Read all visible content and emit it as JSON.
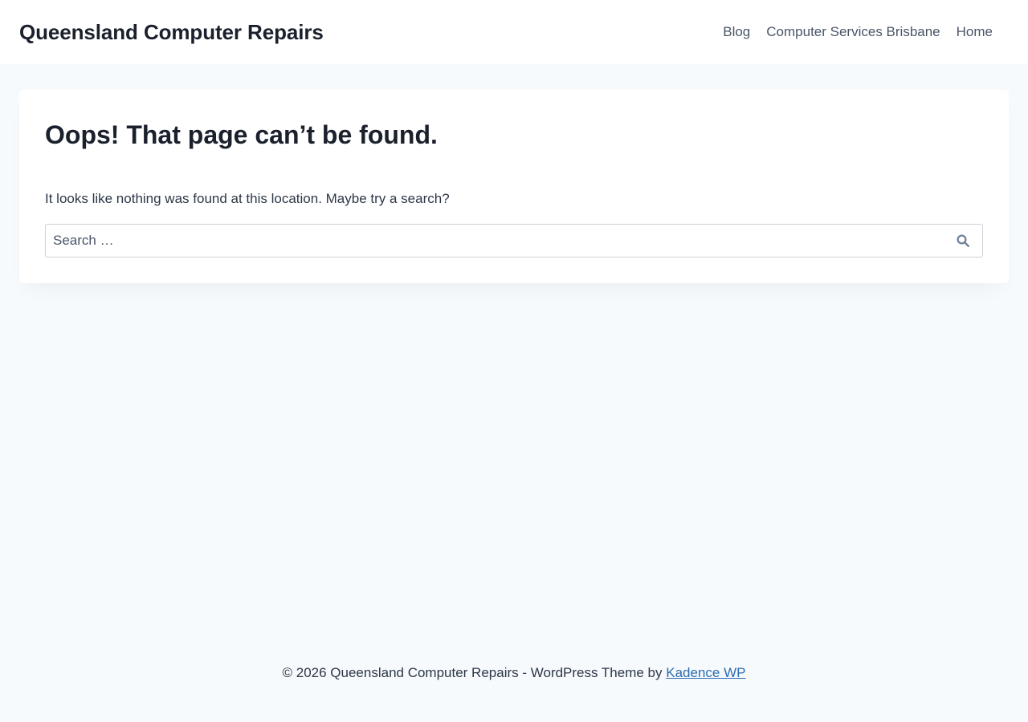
{
  "header": {
    "site_title": "Queensland Computer Repairs",
    "nav": [
      {
        "label": "Blog"
      },
      {
        "label": "Computer Services Brisbane"
      },
      {
        "label": "Home"
      }
    ]
  },
  "main": {
    "title": "Oops! That page can’t be found.",
    "message": "It looks like nothing was found at this location. Maybe try a search?",
    "search": {
      "placeholder": "Search …",
      "value": "",
      "submit_icon": "search-icon"
    }
  },
  "footer": {
    "text": "© 2026 Queensland Computer Repairs - WordPress Theme by",
    "link_label": "Kadence WP"
  },
  "colors": {
    "background": "#f7fafc",
    "surface": "#ffffff",
    "text": "#1a202c",
    "nav_text": "#4a5568",
    "link": "#2b6cb0"
  }
}
